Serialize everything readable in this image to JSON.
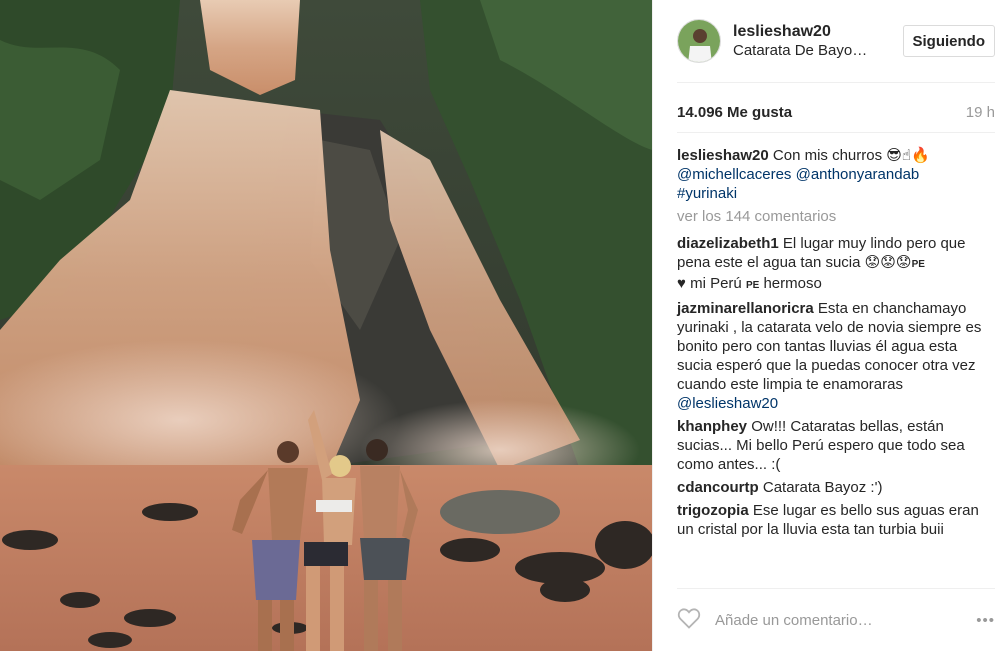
{
  "post": {
    "username": "leslieshaw20",
    "location": "Catarata De Bayo…",
    "follow_label": "Siguiendo",
    "likes": "14.096 Me gusta",
    "time_ago": "19 h",
    "caption": {
      "user": "leslieshaw20",
      "text": "Con mis churros",
      "emoji": "😎☝🔥",
      "mentions": [
        "@michellcaceres",
        "@anthonyarandab"
      ],
      "hashtag": "#yurinaki"
    },
    "view_all_label": "ver los 144 comentarios",
    "comments": [
      {
        "user": "diazelizabeth1",
        "text": "El lugar muy lindo pero que pena este el agua tan sucia 😟😟😟",
        "flag1": "PE",
        "heart": "♥",
        "text2": "mi Perú",
        "flag2": "PE",
        "text3": "hermoso"
      },
      {
        "user": "jazminarellanoricra",
        "text": "Esta en chanchamayo yurinaki , la catarata velo de novia siempre es bonito pero con tantas lluvias él agua esta sucia esperó que la puedas conocer otra vez cuando este limpia te enamoraras",
        "mention": "@leslieshaw20"
      },
      {
        "user": "khanphey",
        "text": "Ow!!! Cataratas bellas, están sucias... Mi bello Perú espero que todo sea como antes... :("
      },
      {
        "user": "cdancourtp",
        "text": "Catarata Bayoz :')"
      },
      {
        "user": "trigozopia",
        "text": "Ese lugar es bello sus aguas eran un cristal por la lluvia esta tan turbia buii"
      }
    ],
    "add_comment_placeholder": "Añade un comentario…",
    "more_label": "•••"
  },
  "icons": {
    "like": "heart-outline-icon",
    "more": "more-dots-icon"
  }
}
